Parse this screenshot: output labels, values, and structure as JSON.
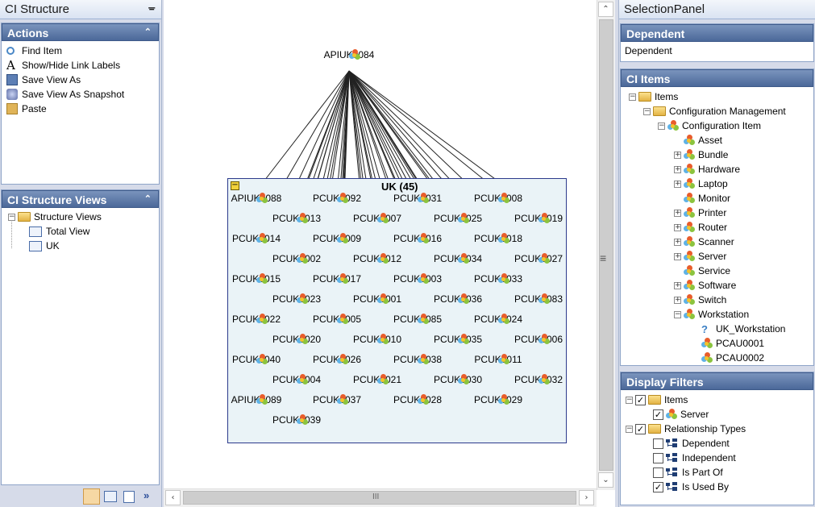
{
  "left_panel": {
    "title": "CI Structure",
    "pin_icon": "pin-icon",
    "actions": {
      "header": "Actions",
      "items": [
        {
          "label": "Find Item",
          "icon": "magnifier-icon"
        },
        {
          "label": "Show/Hide Link Labels",
          "icon": "letter-a-icon"
        },
        {
          "label": "Save View As",
          "icon": "save-view-icon"
        },
        {
          "label": "Save View As Snapshot",
          "icon": "snapshot-icon"
        },
        {
          "label": "Paste",
          "icon": "paste-icon"
        }
      ]
    },
    "views": {
      "header": "CI Structure Views",
      "root": "Structure Views",
      "items": [
        "Total View",
        "UK"
      ]
    }
  },
  "canvas": {
    "root_node": "APIUK0084",
    "group_label": "UK (45)",
    "nodes": [
      "APIUK0088",
      "PCUK0092",
      "PCUK0031",
      "PCUK0008",
      "PCUK0013",
      "PCUK0007",
      "PCUK0025",
      "PCUK0019",
      "PCUK0014",
      "PCUK0009",
      "PCUK0016",
      "PCUK0018",
      "PCUK0002",
      "PCUK0012",
      "PCUK0034",
      "PCUK0027",
      "PCUK0015",
      "PCUK0017",
      "PCUK0003",
      "PCUK0033",
      "PCUK0023",
      "PCUK0001",
      "PCUK0036",
      "PCUK0083",
      "PCUK0022",
      "PCUK0005",
      "PCUK0085",
      "PCUK0024",
      "PCUK0020",
      "PCUK0010",
      "PCUK0035",
      "PCUK0006",
      "PCUK0040",
      "PCUK0026",
      "PCUK0038",
      "PCUK0011",
      "PCUK0004",
      "PCUK0021",
      "PCUK0030",
      "PCUK0032",
      "APIUK0089",
      "PCUK0037",
      "PCUK0028",
      "PCUK0029",
      "PCUK0039"
    ]
  },
  "right_panel": {
    "title": "SelectionPanel",
    "dependent": {
      "header": "Dependent",
      "value": "Dependent"
    },
    "ci_items": {
      "header": "CI Items",
      "root": "Items",
      "cm": "Configuration Management",
      "ci": "Configuration Item",
      "types": [
        {
          "label": "Asset",
          "expandable": false
        },
        {
          "label": "Bundle",
          "expandable": true
        },
        {
          "label": "Hardware",
          "expandable": true
        },
        {
          "label": "Laptop",
          "expandable": true
        },
        {
          "label": "Monitor",
          "expandable": false
        },
        {
          "label": "Printer",
          "expandable": true
        },
        {
          "label": "Router",
          "expandable": true
        },
        {
          "label": "Scanner",
          "expandable": true
        },
        {
          "label": "Server",
          "expandable": true
        },
        {
          "label": "Service",
          "expandable": false
        },
        {
          "label": "Software",
          "expandable": true
        },
        {
          "label": "Switch",
          "expandable": true
        },
        {
          "label": "Workstation",
          "expandable": true
        }
      ],
      "workstation_children": [
        "UK_Workstation",
        "PCAU0001",
        "PCAU0002"
      ]
    },
    "display_filters": {
      "header": "Display Filters",
      "items_label": "Items",
      "server_label": "Server",
      "rel_label": "Relationship Types",
      "relations": [
        {
          "label": "Dependent",
          "checked": false
        },
        {
          "label": "Independent",
          "checked": false
        },
        {
          "label": "Is Part Of",
          "checked": false
        },
        {
          "label": "Is Used By",
          "checked": true
        }
      ]
    }
  },
  "scroll": {
    "grip": "≡",
    "hgrip": "III"
  }
}
